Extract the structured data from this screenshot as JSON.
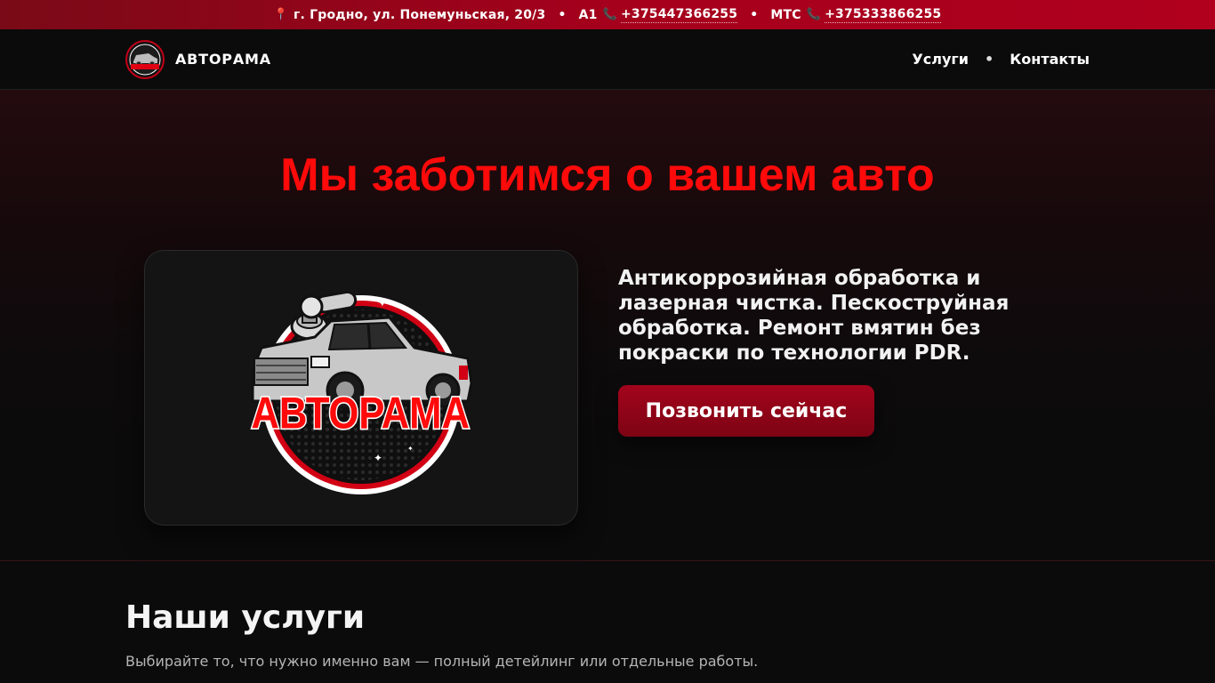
{
  "topbar": {
    "address": "г. Гродно, ул. Понемуньская, 20/3",
    "sep1": "•",
    "a1_label": "A1",
    "a1_phone": "+375447366255",
    "sep2": "•",
    "mts_label": "МТС",
    "mts_phone": "+375333866255"
  },
  "nav": {
    "brand": "АВТОРАМА",
    "menu": [
      "Услуги",
      "Контакты"
    ],
    "dot": "•"
  },
  "hero": {
    "title": "Мы заботимся о вашем авто",
    "description": "Антикоррозийная обработка и лазерная чистка. Пескоструйная обработка. Ремонт вмятин без покраски по технологии PDR.",
    "cta": "Позвонить сейчас",
    "logo_text": "АВТОРАМА"
  },
  "services": {
    "title": "Наши услуги",
    "subtitle": "Выбирайте то, что нужно именно вам — полный детейлинг или отдельные работы."
  },
  "colors": {
    "accent_red": "#ff0a0a",
    "topbar_red": "#a5001c",
    "button_red": "#8f0418"
  }
}
